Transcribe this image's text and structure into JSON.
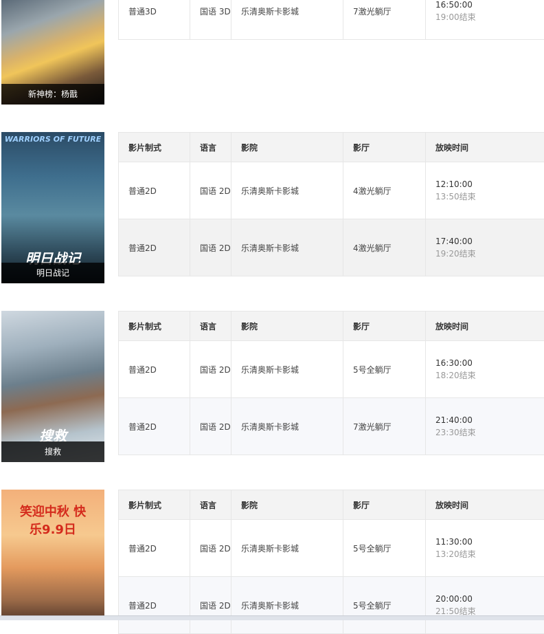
{
  "headers": {
    "format": "影片制式",
    "language": "语言",
    "cinema": "影院",
    "hall": "影厅",
    "showtime": "放映时间"
  },
  "movies": [
    {
      "title": "新神榜：杨戬",
      "rows": [
        {
          "format": "普通3D",
          "language": "国语 3D",
          "cinema": "乐清奥斯卡影城",
          "hall": "7激光躺厅",
          "start": "16:50:00",
          "end": "19:00结束"
        }
      ]
    },
    {
      "title": "明日战记",
      "poster_text": "WARRIORS OF FUTURE",
      "poster_subtext": "明日战记",
      "rows": [
        {
          "format": "普通2D",
          "language": "国语 2D",
          "cinema": "乐清奥斯卡影城",
          "hall": "4激光躺厅",
          "start": "12:10:00",
          "end": "13:50结束"
        },
        {
          "format": "普通2D",
          "language": "国语 2D",
          "cinema": "乐清奥斯卡影城",
          "hall": "4激光躺厅",
          "start": "17:40:00",
          "end": "19:20结束"
        }
      ]
    },
    {
      "title": "搜救",
      "poster_subtext": "搜救",
      "rows": [
        {
          "format": "普通2D",
          "language": "国语 2D",
          "cinema": "乐清奥斯卡影城",
          "hall": "5号全躺厅",
          "start": "16:30:00",
          "end": "18:20结束"
        },
        {
          "format": "普通2D",
          "language": "国语 2D",
          "cinema": "乐清奥斯卡影城",
          "hall": "7激光躺厅",
          "start": "21:40:00",
          "end": "23:30结束"
        }
      ]
    },
    {
      "title": "",
      "poster_text": "笑迎中秋 快乐9.9日",
      "rows": [
        {
          "format": "普通2D",
          "language": "国语 2D",
          "cinema": "乐清奥斯卡影城",
          "hall": "5号全躺厅",
          "start": "11:30:00",
          "end": "13:20结束"
        },
        {
          "format": "普通2D",
          "language": "国语 2D",
          "cinema": "乐清奥斯卡影城",
          "hall": "5号全躺厅",
          "start": "20:00:00",
          "end": "21:50结束"
        }
      ]
    }
  ]
}
